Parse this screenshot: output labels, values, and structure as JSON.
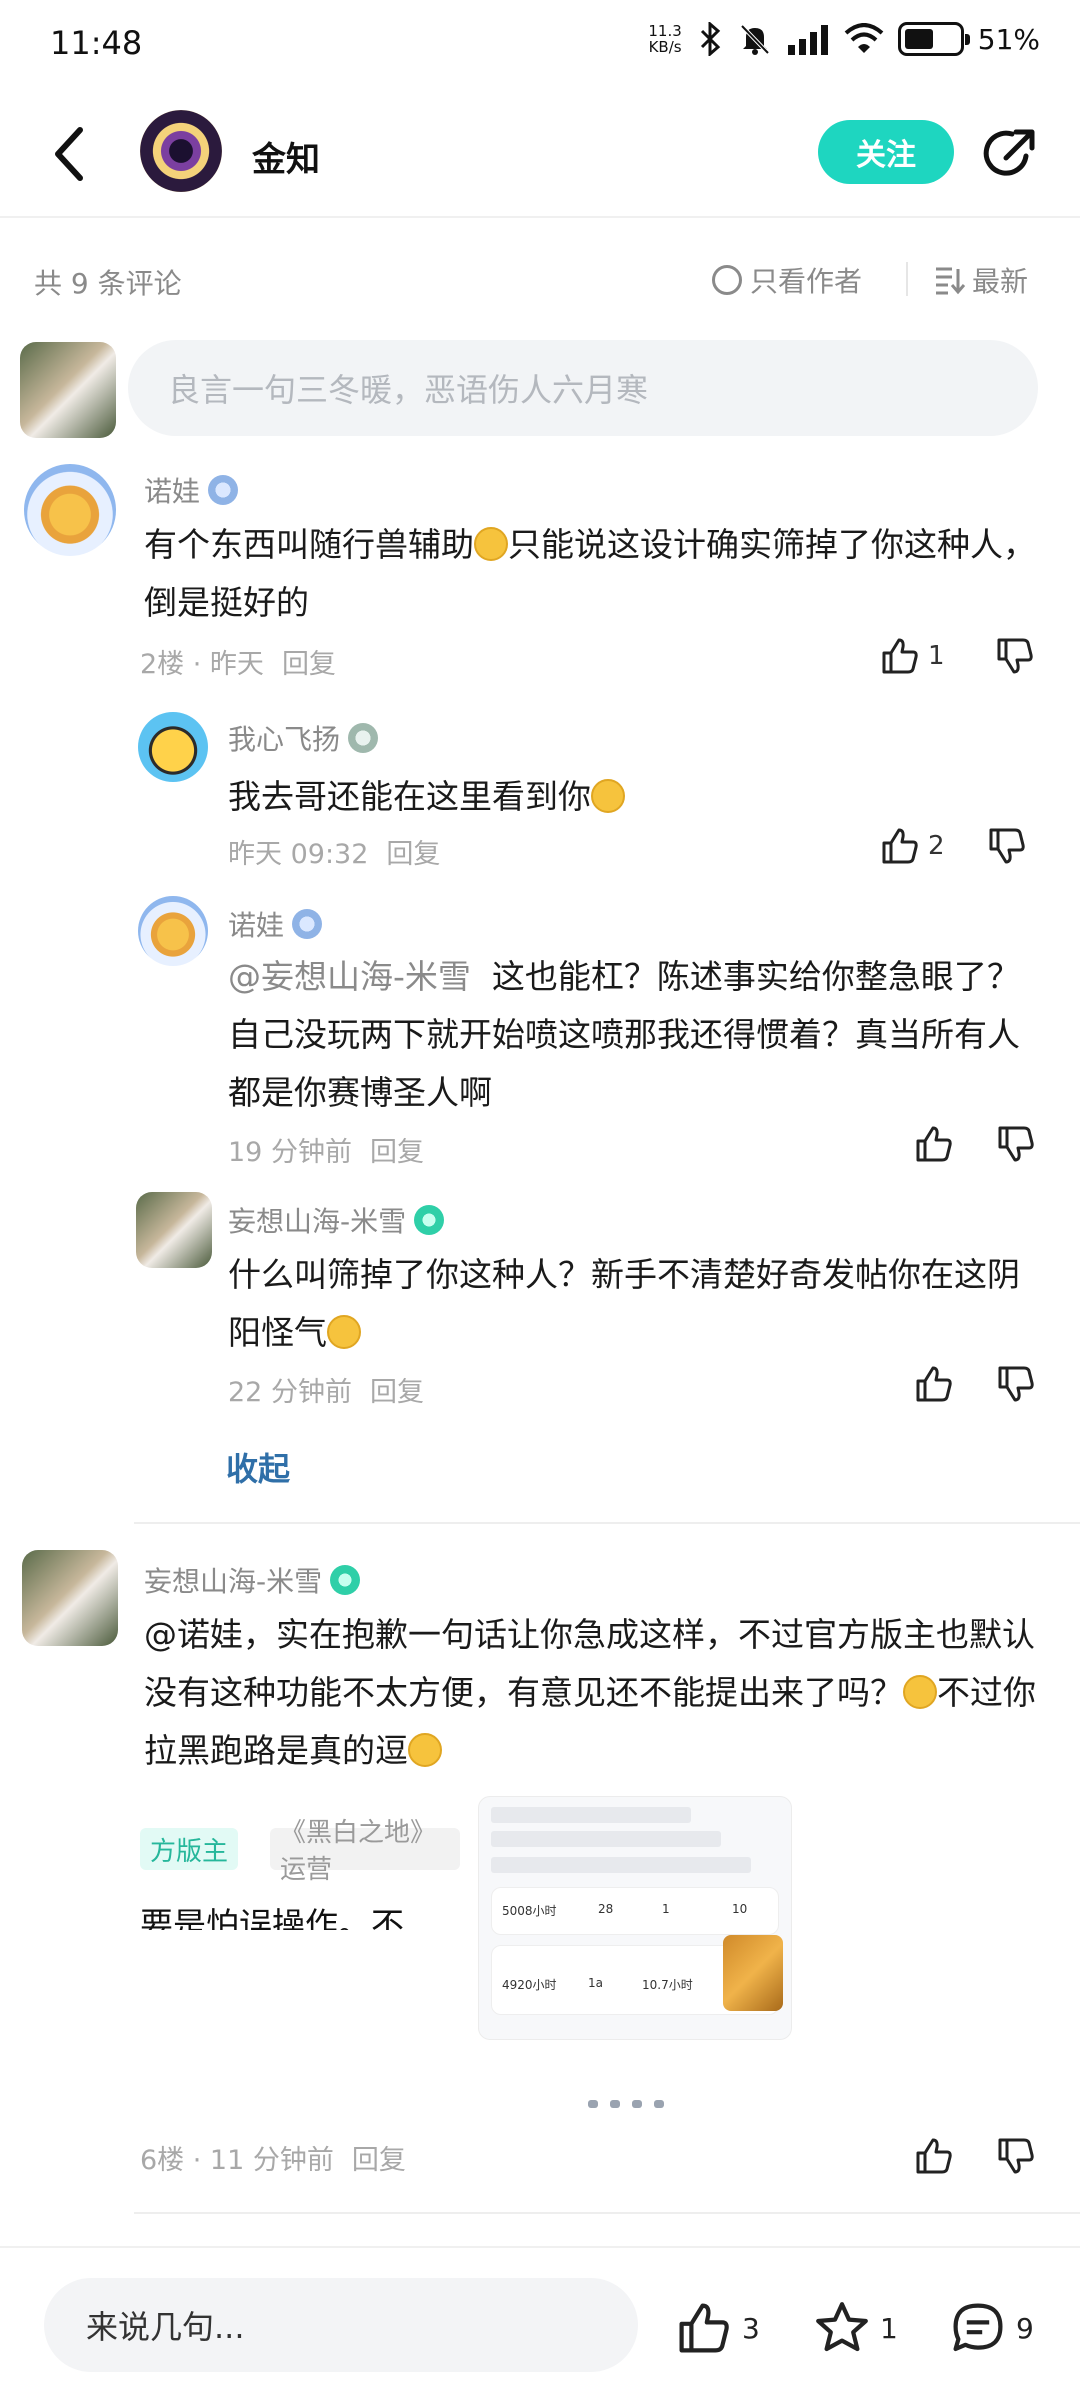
{
  "status_bar": {
    "time": "11:48",
    "net_speed": "11.3",
    "net_unit": "KB/s",
    "battery": "51%"
  },
  "header": {
    "name": "金知",
    "follow": "关注"
  },
  "comments_bar": {
    "count": "共 9 条评论",
    "only_author": "只看作者",
    "sort": "最新"
  },
  "input_placeholder": "良言一句三冬暖，恶语伤人六月寒",
  "comments": [
    {
      "user": "诺娃",
      "text_a": "有个东西叫随行兽辅助",
      "text_b": "只能说这设计确实筛掉了你这种人，倒是挺好的",
      "floor": "2楼 · 昨天",
      "reply": "回复",
      "likes": "1",
      "replies": [
        {
          "user": "我心飞扬",
          "text": "我去哥还能在这里看到你",
          "time": "昨天 09:32",
          "reply": "回复",
          "likes": "2"
        },
        {
          "user": "诺娃",
          "mention": "@妄想山海-米雪",
          "text": "这也能杠？陈述事实给你整急眼了？自己没玩两下就开始喷这喷那我还得惯着？真当所有人都是你赛博圣人啊",
          "time": "19 分钟前",
          "reply": "回复"
        },
        {
          "user": "妄想山海-米雪",
          "text": "什么叫筛掉了你这种人？新手不清楚好奇发帖你在这阴阳怪气",
          "time": "22 分钟前",
          "reply": "回复"
        }
      ],
      "collapse": "收起"
    },
    {
      "user": "妄想山海-米雪",
      "text_a": "@诺娃，实在抱歉一句话让你急成这样，不过官方版主也默认没有这种功能不太方便，有意见还不能提出来了吗？",
      "text_b": "不过你拉黑跑路是真的逗",
      "image1": {
        "chip1": "方版主",
        "chip2": "《黑白之地》运营",
        "line": "要是怕误操作。不"
      },
      "image2": {
        "s1": "5008小时",
        "s2": "28",
        "s3": "1",
        "s4": "10",
        "s5": "4920小时",
        "s6": "1a",
        "s7": "10.7小时"
      },
      "floor": "6楼 · 11 分钟前",
      "reply": "回复"
    }
  ],
  "bottom_bar": {
    "input": "来说几句...",
    "likes": "3",
    "stars": "1",
    "comments": "9"
  },
  "colors": {
    "accent": "#1ed6c0",
    "link": "#2f6fa8",
    "muted": "#8a8a8a"
  }
}
